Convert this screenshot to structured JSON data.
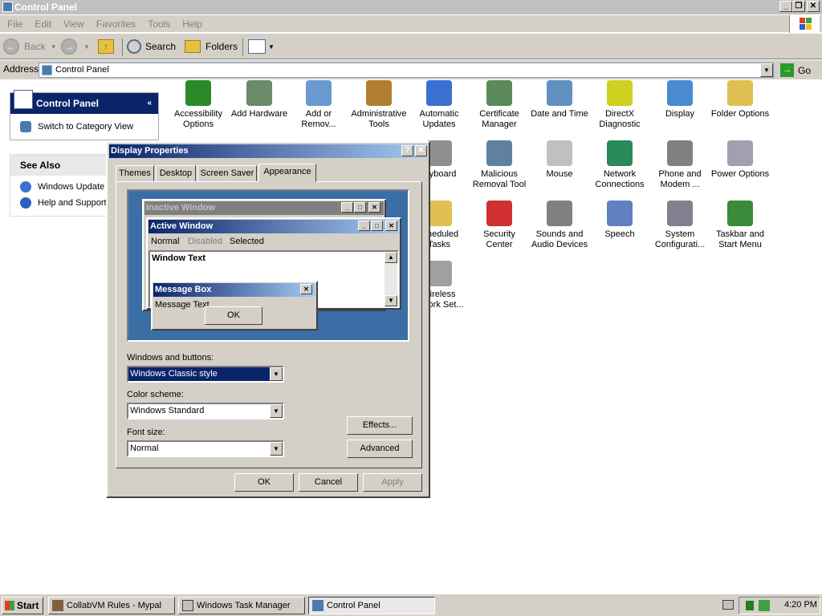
{
  "window": {
    "title": "Control Panel"
  },
  "menu": [
    "File",
    "Edit",
    "View",
    "Favorites",
    "Tools",
    "Help"
  ],
  "toolbar": {
    "back": "Back",
    "search": "Search",
    "folders": "Folders"
  },
  "address": {
    "label": "Address",
    "value": "Control Panel",
    "go": "Go"
  },
  "left": {
    "header": "Control Panel",
    "switch": "Switch to Category View",
    "see_also": "See Also",
    "links": [
      "Windows Update",
      "Help and Support"
    ]
  },
  "icons": [
    {
      "label": "Accessibility Options",
      "color": "#2a8a2a"
    },
    {
      "label": "Add Hardware",
      "color": "#6a8a6a"
    },
    {
      "label": "Add or Remov...",
      "color": "#6a9ad0"
    },
    {
      "label": "Administrative Tools",
      "color": "#b08030"
    },
    {
      "label": "Automatic Updates",
      "color": "#3a70d0"
    },
    {
      "label": "Certificate Manager",
      "color": "#5a8a5a"
    },
    {
      "label": "Date and Time",
      "color": "#6090c0"
    },
    {
      "label": "DirectX Diagnostic",
      "color": "#d0d020"
    },
    {
      "label": "Display",
      "color": "#4a8ad0"
    },
    {
      "label": "Folder Options",
      "color": "#e0c050"
    },
    {
      "label": "...yboard",
      "color": "#909090"
    },
    {
      "label": "Malicious Removal Tool",
      "color": "#6080a0"
    },
    {
      "label": "Mouse",
      "color": "#c0c0c0"
    },
    {
      "label": "Network Connections",
      "color": "#2a8a5a"
    },
    {
      "label": "Phone and Modem ...",
      "color": "#808080"
    },
    {
      "label": "Power Options",
      "color": "#a0a0b0"
    },
    {
      "label": "...heduled Tasks",
      "color": "#e0c050"
    },
    {
      "label": "Security Center",
      "color": "#d03030"
    },
    {
      "label": "Sounds and Audio Devices",
      "color": "#808080"
    },
    {
      "label": "Speech",
      "color": "#6080c0"
    },
    {
      "label": "System Configurati...",
      "color": "#808090"
    },
    {
      "label": "Taskbar and Start Menu",
      "color": "#3a8a3a"
    },
    {
      "label": "...ireless ...work Set...",
      "color": "#a0a0a0"
    }
  ],
  "dialog": {
    "title": "Display Properties",
    "tabs": [
      "Themes",
      "Desktop",
      "Screen Saver",
      "Appearance"
    ],
    "preview": {
      "inactive": "Inactive Window",
      "active": "Active Window",
      "menu": [
        "Normal",
        "Disabled",
        "Selected"
      ],
      "window_text": "Window Text",
      "msgbox": "Message Box",
      "msgtext": "Message Text",
      "ok": "OK"
    },
    "windows_label": "Windows and buttons:",
    "windows_value": "Windows Classic style",
    "scheme_label": "Color scheme:",
    "scheme_value": "Windows Standard",
    "font_label": "Font size:",
    "font_value": "Normal",
    "effects": "Effects...",
    "advanced": "Advanced",
    "ok": "OK",
    "cancel": "Cancel",
    "apply": "Apply"
  },
  "taskbar": {
    "start": "Start",
    "tasks": [
      "CollabVM Rules - Mypal",
      "Windows Task Manager",
      "Control Panel"
    ],
    "clock": "4:20 PM"
  }
}
